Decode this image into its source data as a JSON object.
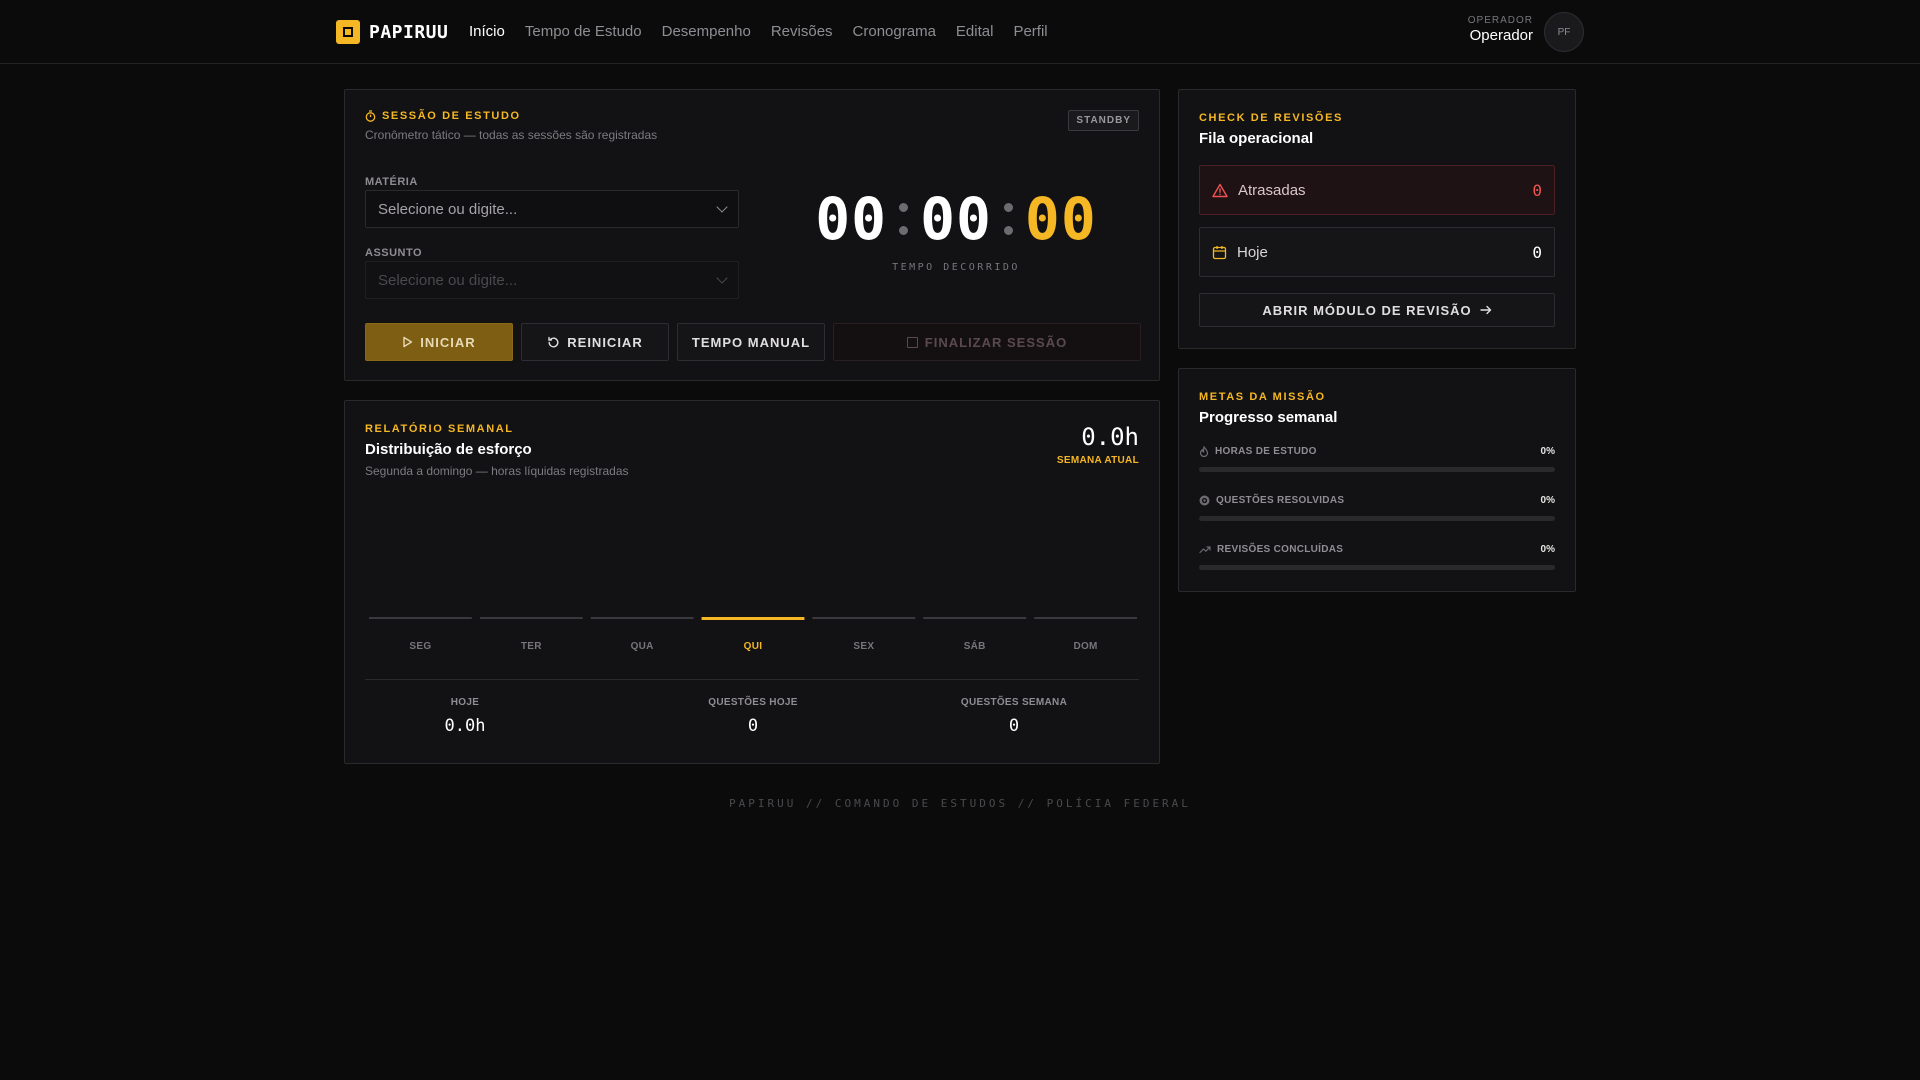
{
  "app": {
    "name": "PAPIRUU"
  },
  "nav": {
    "items": [
      {
        "label": "Início",
        "active": true
      },
      {
        "label": "Tempo de Estudo",
        "active": false
      },
      {
        "label": "Desempenho",
        "active": false
      },
      {
        "label": "Revisões",
        "active": false
      },
      {
        "label": "Cronograma",
        "active": false
      },
      {
        "label": "Edital",
        "active": false
      },
      {
        "label": "Perfil",
        "active": false
      }
    ]
  },
  "user": {
    "role_label": "OPERADOR",
    "name": "Operador",
    "initials": "PF"
  },
  "session": {
    "kicker": "SESSÃO DE ESTUDO",
    "subtitle": "Cronômetro tático — todas as sessões são registradas",
    "status": "STANDBY",
    "subject_label": "MATÉRIA",
    "subject_placeholder": "Selecione ou digite...",
    "topic_label": "ASSUNTO",
    "topic_placeholder": "Selecione ou digite...",
    "timer": {
      "hours": "00",
      "minutes": "00",
      "seconds": "00"
    },
    "timer_label": "TEMPO DECORRIDO",
    "buttons": {
      "start": "INICIAR",
      "reset": "REINICIAR",
      "manual": "TEMPO MANUAL",
      "finish": "FINALIZAR SESSÃO"
    }
  },
  "report": {
    "kicker": "RELATÓRIO SEMANAL",
    "title": "Distribuição de esforço",
    "subtitle": "Segunda a domingo — horas líquidas registradas",
    "total": "0.0h",
    "total_label": "SEMANA ATUAL",
    "stats": [
      {
        "label": "HOJE",
        "value": "0.0h"
      },
      {
        "label": "QUESTÕES HOJE",
        "value": "0"
      },
      {
        "label": "QUESTÕES SEMANA",
        "value": "0"
      }
    ]
  },
  "chart_data": {
    "type": "bar",
    "categories": [
      "SEG",
      "TER",
      "QUA",
      "QUI",
      "SEX",
      "SÁB",
      "DOM"
    ],
    "values": [
      0,
      0,
      0,
      0,
      0,
      0,
      0
    ],
    "highlight_index": 3,
    "title": "Distribuição de esforço",
    "xlabel": "",
    "ylabel": "",
    "grid": false,
    "colors": {
      "bar": "#3a393d",
      "highlight": "#f5b724"
    }
  },
  "reviews": {
    "kicker": "CHECK DE REVISÕES",
    "title": "Fila operacional",
    "late_label": "Atrasadas",
    "late_count": "0",
    "today_label": "Hoje",
    "today_count": "0",
    "open_button": "ABRIR MÓDULO DE REVISÃO"
  },
  "goals": {
    "kicker": "METAS DA MISSÃO",
    "title": "Progresso semanal",
    "items": [
      {
        "label": "HORAS DE ESTUDO",
        "percent": "0%",
        "progress": 0,
        "icon": "flame-icon"
      },
      {
        "label": "QUESTÕES RESOLVIDAS",
        "percent": "0%",
        "progress": 0,
        "icon": "target-icon"
      },
      {
        "label": "REVISÕES CONCLUÍDAS",
        "percent": "0%",
        "progress": 0,
        "icon": "trending-up-icon"
      }
    ]
  },
  "footer": "PAPIRUU // COMANDO DE ESTUDOS // POLÍCIA FEDERAL",
  "colors": {
    "accent": "#f5b724",
    "danger": "#f05252",
    "background": "#0c0b0c",
    "panel": "#121113"
  }
}
